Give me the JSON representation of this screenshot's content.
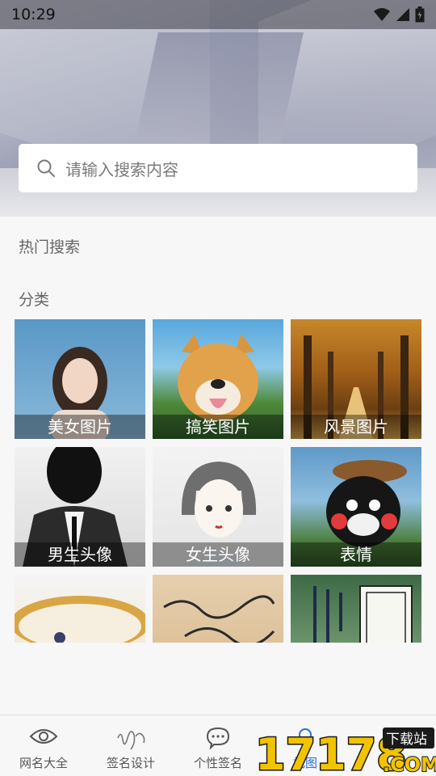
{
  "status_bar": {
    "time": "10:29"
  },
  "search": {
    "placeholder": "请输入搜索内容"
  },
  "sections": {
    "hot_title": "热门搜索",
    "category_title": "分类"
  },
  "categories": [
    {
      "label": "美女图片"
    },
    {
      "label": "搞笑图片"
    },
    {
      "label": "风景图片"
    },
    {
      "label": "男生头像"
    },
    {
      "label": "女生头像"
    },
    {
      "label": "表情"
    },
    {
      "label": ""
    },
    {
      "label": ""
    },
    {
      "label": ""
    }
  ],
  "bottom_nav": [
    {
      "label": "网名大全",
      "icon": "eye-icon"
    },
    {
      "label": "签名设计",
      "icon": "signature-icon"
    },
    {
      "label": "个性签名",
      "icon": "chat-bubble-icon"
    },
    {
      "label": "找图",
      "icon": "find-image-icon"
    },
    {
      "label": "",
      "icon": "gear-icon"
    }
  ],
  "watermark": {
    "text": "17178",
    "badge": "下载站",
    "suffix": ".COM"
  },
  "colors": {
    "active_tab": "#2a6fd6",
    "overlay": "rgba(0,0,0,0.38)"
  }
}
